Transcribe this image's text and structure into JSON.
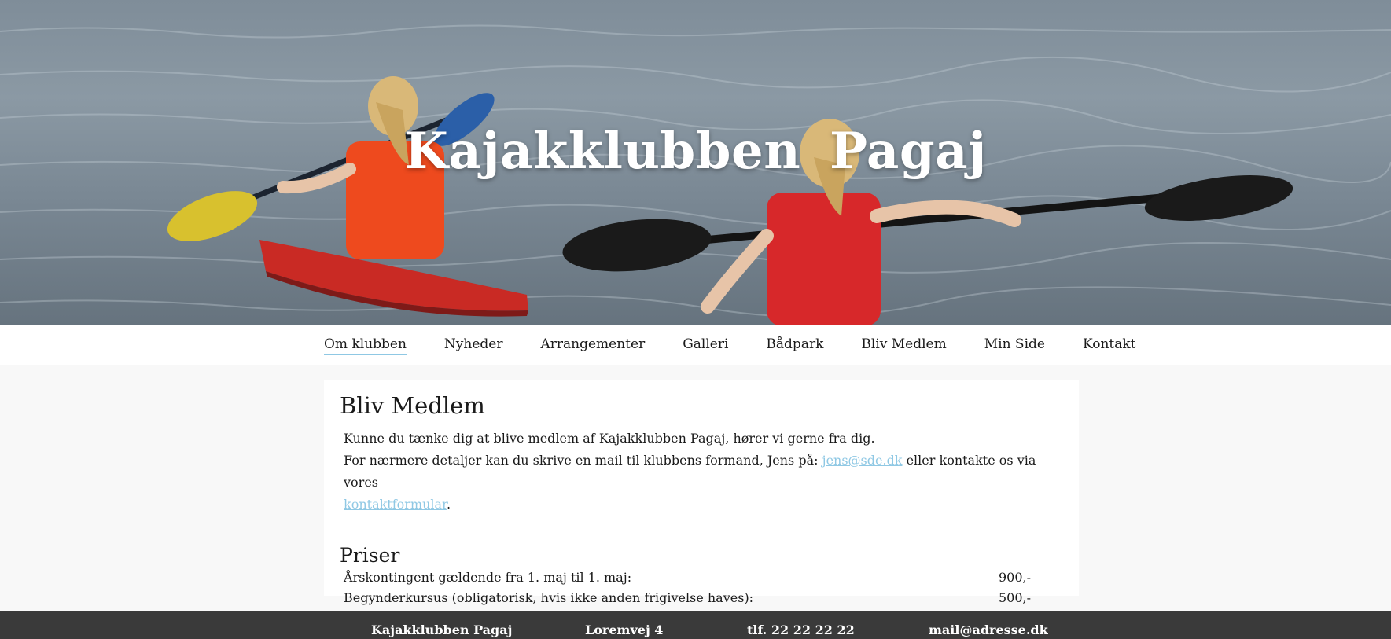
{
  "hero": {
    "title": "Kajakklubben  Pagaj",
    "image_icon": "kayakers-photo"
  },
  "nav": {
    "items": [
      {
        "label": "Om klubben",
        "active": true
      },
      {
        "label": "Nyheder",
        "active": false
      },
      {
        "label": "Arrangementer",
        "active": false
      },
      {
        "label": "Galleri",
        "active": false
      },
      {
        "label": "Bådpark",
        "active": false
      },
      {
        "label": "Bliv Medlem",
        "active": false
      },
      {
        "label": "Min Side",
        "active": false
      },
      {
        "label": "Kontakt",
        "active": false
      }
    ]
  },
  "main": {
    "heading": "Bliv Medlem",
    "intro_line1": "Kunne du tænke dig at blive medlem af Kajakklubben Pagaj, hører vi gerne fra dig.",
    "intro_line2_prefix": "For nærmere detaljer kan du skrive en mail til klubbens formand, Jens på: ",
    "email_link": "jens@sde.dk",
    "intro_line2_middle": " eller kontakte os via vores",
    "contact_link": "kontaktformular",
    "intro_line3_suffix": ".",
    "prices_heading": "Priser",
    "prices": [
      {
        "label": "Årskontingent gældende fra 1. maj til 1. maj:",
        "amount": "900,-"
      },
      {
        "label": "Begynderkursus (obligatorisk, hvis ikke anden frigivelse haves):",
        "amount": "500,-"
      }
    ]
  },
  "footer": {
    "club_name": "Kajakklubben Pagaj",
    "address": "Loremvej 4",
    "phone": "tlf. 22 22 22 22",
    "email": "mail@adresse.dk"
  },
  "colors": {
    "link": "#8fc8e4",
    "footer_bg": "#3a3a3a",
    "page_bg": "#f8f8f8"
  }
}
